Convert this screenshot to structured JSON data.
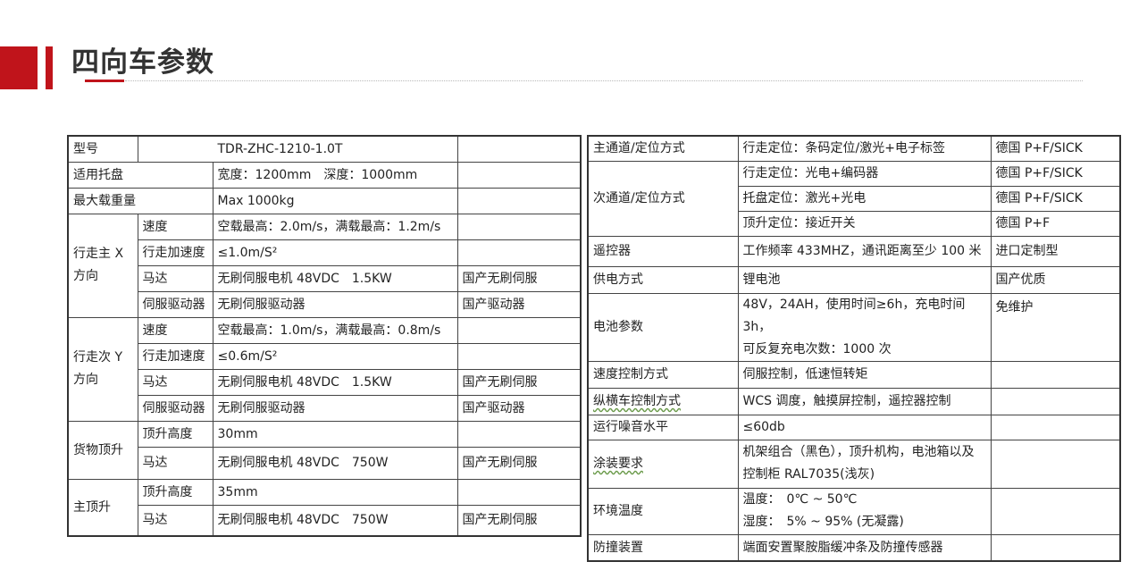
{
  "page": {
    "title": "四向车参数"
  },
  "colors": {
    "accent": "#c0141b"
  },
  "left_table": {
    "model_label": "型号",
    "model_value": "TDR-ZHC-1210-1.0T",
    "pallet_label": "适用托盘",
    "pallet_value": "宽度：1200mm　深度：1000mm",
    "load_label": "最大载重量",
    "load_value": "Max 1000kg",
    "x_group_label": "行走主 X 方向",
    "x_speed_label": "速度",
    "x_speed_value": "空载最高：2.0m/s，满载最高：1.2m/s",
    "x_accel_label": "行走加速度",
    "x_accel_value": "≤1.0m/S²",
    "x_motor_label": "马达",
    "x_motor_value": "无刷伺服电机  48VDC　1.5KW",
    "x_motor_note": "国产无刷伺服",
    "x_driver_label": "伺服驱动器",
    "x_driver_value": "无刷伺服驱动器",
    "x_driver_note": "国产驱动器",
    "y_group_label": "行走次 Y 方向",
    "y_speed_label": "速度",
    "y_speed_value": "空载最高：1.0m/s，满载最高：0.8m/s",
    "y_accel_label": "行走加速度",
    "y_accel_value": "≤0.6m/S²",
    "y_motor_label": "马达",
    "y_motor_value": "无刷伺服电机  48VDC　1.5KW",
    "y_motor_note": "国产无刷伺服",
    "y_driver_label": "伺服驱动器",
    "y_driver_value": "无刷伺服驱动器",
    "y_driver_note": "国产驱动器",
    "cargo_group_label": "货物顶升",
    "cargo_height_label": "顶升高度",
    "cargo_height_value": "30mm",
    "cargo_motor_label": "马达",
    "cargo_motor_value": "无刷伺服电机  48VDC　750W",
    "cargo_motor_note": "国产无刷伺服",
    "main_group_label": "主顶升",
    "main_height_label": "顶升高度",
    "main_height_value": "35mm",
    "main_motor_label": "马达",
    "main_motor_value": "无刷伺服电机  48VDC　750W",
    "main_motor_note": "国产无刷伺服"
  },
  "right_table": {
    "main_channel_label": "主通道/定位方式",
    "main_channel_value": "行走定位：条码定位/激光+电子标签",
    "main_channel_note": "德国 P+F/SICK",
    "sub_channel_label": "次通道/定位方式",
    "sub_1_value": "行走定位：光电+编码器",
    "sub_1_note": "德国 P+F/SICK",
    "sub_2_value": "托盘定位：激光+光电",
    "sub_2_note": "德国 P+F/SICK",
    "sub_3_value": "顶升定位：接近开关",
    "sub_3_note": "德国 P+F",
    "remote_label": "遥控器",
    "remote_value": "工作频率 433MHZ，通讯距离至少 100 米",
    "remote_note": "进口定制型",
    "power_label": "供电方式",
    "power_value": "锂电池",
    "power_note": "国产优质",
    "battery_label": "电池参数",
    "battery_value_1": "48V，24AH，使用时间≥6h，充电时间 3h，",
    "battery_value_2": "可反复充电次数：1000 次",
    "battery_note": "免维护",
    "speedctl_label": "速度控制方式",
    "speedctl_value": "伺服控制，低速恒转矩",
    "ctrl_label": "纵横车控制方式",
    "ctrl_value": "WCS 调度，触摸屏控制，遥控器控制",
    "noise_label": "运行噪音水平",
    "noise_value": "≤60db",
    "paint_label": "涂装要求",
    "paint_value_1": "机架组合（黑色），顶升机构，电池箱以及",
    "paint_value_2": "控制柜 RAL7035(浅灰)",
    "env_label": "环境温度",
    "env_value_1": "温度：　0℃ ~ 50℃",
    "env_value_2": "湿度：　5% ~ 95% (无凝露)",
    "anti_label": "防撞装置",
    "anti_value": "端面安置聚胺脂缓冲条及防撞传感器"
  }
}
